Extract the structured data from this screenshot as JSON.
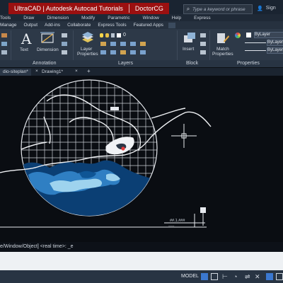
{
  "title_bar": {
    "overlay_left": "UltraCAD | Autodesk Autocad Tutorials",
    "overlay_right": "DoctorCG",
    "search_placeholder": "Type a keyword or phrase",
    "sign_label": "Sign"
  },
  "menubar": {
    "items": [
      "Tools",
      "Draw",
      "Dimension",
      "Modify",
      "Parametric",
      "Window",
      "Help",
      "Express"
    ]
  },
  "ribbon_tabs": {
    "items": [
      "Manage",
      "Output",
      "Add-ins",
      "Collaborate",
      "Express Tools",
      "Featured Apps"
    ]
  },
  "ribbon": {
    "text_label": "Text",
    "dimension_label": "Dimension",
    "annotation_panel": "Annotation",
    "layer_properties_label_1": "Layer",
    "layer_properties_label_2": "Properties",
    "layers_panel": "Layers",
    "insert_label": "Insert",
    "block_panel": "Block",
    "match_label_1": "Match",
    "match_label_2": "Properties",
    "properties_panel": "Properties",
    "layer_value": "0",
    "bylayer_1": "ByLayer",
    "bylayer_2": "ByLayer",
    "bylayer_3": "ByLayer"
  },
  "doc_tabs": {
    "tab1": "dio-siteplan*",
    "tab2": "Drawing1*",
    "add_tab": "+"
  },
  "viewport": {
    "small_text_1": "##.1.###",
    "small_text_2": "ˍˍˍˍˍ"
  },
  "command_line": {
    "history": "e/Window/Object] <real time>: _e"
  },
  "status_bar": {
    "model_label": "MODEL"
  },
  "colors": {
    "title_overlay": "#9b1010",
    "water_deep": "#0b3f74",
    "water_mid": "#2f7fc3",
    "water_light": "#9ed3ee",
    "grid": "#c9ced5"
  }
}
